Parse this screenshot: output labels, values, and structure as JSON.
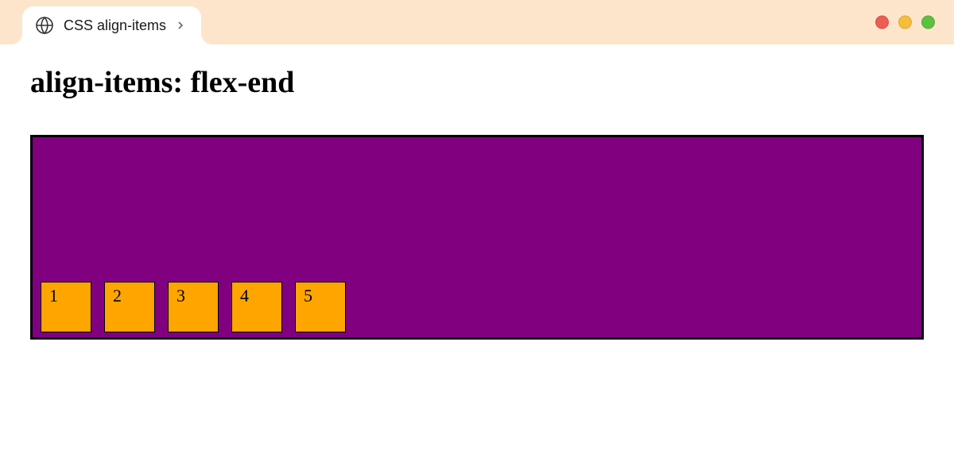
{
  "tab": {
    "title": "CSS align-items"
  },
  "page": {
    "heading": "align-items: flex-end"
  },
  "demo": {
    "boxes": [
      "1",
      "2",
      "3",
      "4",
      "5"
    ],
    "container_color": "#800080",
    "box_color": "#ffa500",
    "align_items": "flex-end"
  }
}
